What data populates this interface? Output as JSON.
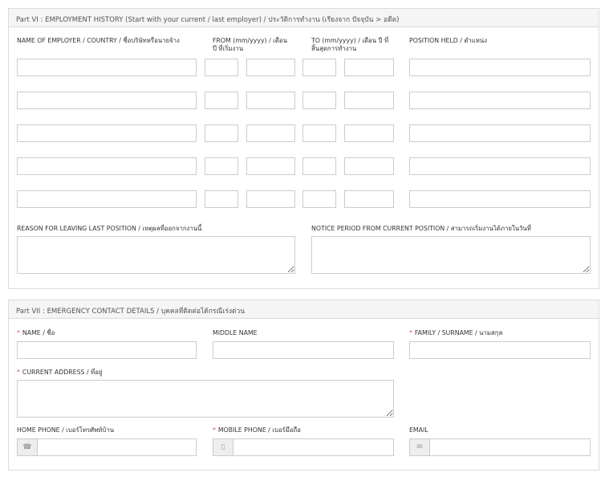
{
  "part6": {
    "title": "Part VI : EMPLOYMENT HISTORY (Start with your current / last employer) / ประวัติการทำงาน (เรียงจาก ปัจจุบัน > อดีต)",
    "col_employer": "NAME OF EMPLOYER / COUNTRY / ชื่อบริษัทหรือนายจ้าง",
    "col_from_1": "FROM (mm/yyyy) / เดือน",
    "col_from_2": "ปี ที่เริ่มงาน",
    "col_to_1": "TO (mm/yyyy) / เดือน ปี ที่",
    "col_to_2": "สิ้นสุดการทำงาน",
    "col_position": "POSITION HELD / ตำแหน่ง",
    "reason_label": "REASON FOR LEAVING LAST POSITION / เหตุผลที่ออกจากงานนี้",
    "notice_label": "NOTICE PERIOD FROM CURRENT POSITION / สามารถเริ่มงานได้ภายในวันที่"
  },
  "part7": {
    "title": "Part VII : EMERGENCY CONTACT DETAILS / บุคคลที่ติดต่อได้กรณีเร่งด่วน",
    "name_label": "NAME / ชื่อ",
    "middle_label": "MIDDLE NAME",
    "surname_label": "FAMILY / SURNAME / นามสกุล",
    "address_label": "CURRENT ADDRESS / ที่อยู่",
    "home_phone_label": "HOME PHONE / เบอร์โทรศัพท์บ้าน",
    "mobile_label": "MOBILE PHONE / เบอร์มือถือ",
    "email_label": "EMAIL",
    "required_mark": "*"
  },
  "icons": {
    "phone": "☎",
    "mobile": "▯",
    "email": "✉"
  }
}
